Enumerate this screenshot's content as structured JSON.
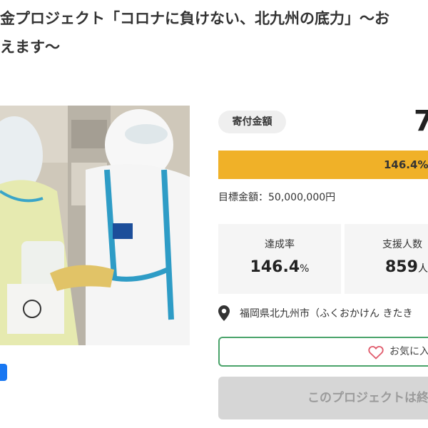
{
  "project": {
    "title_line1": "金プロジェクト「コロナに負けない、北九州の底力」〜お",
    "title_line2": "えます〜"
  },
  "donation": {
    "badge_label": "寄付金額",
    "amount": "7",
    "progress_text": "146.4%",
    "progress_fraction": 1.0,
    "goal_label": "目標金額：",
    "goal_value": "50,000,000円"
  },
  "stats": {
    "achievement_label": "達成率",
    "achievement_value": "146.4",
    "achievement_unit": "%",
    "supporters_label": "支援人数",
    "supporters_value": "859",
    "supporters_unit": "人"
  },
  "location": {
    "text": "福岡県北九州市（ふくおかけん きたき"
  },
  "actions": {
    "favorite_label": "お気に入",
    "ended_label": "このプロジェクトは終"
  },
  "colors": {
    "progress_bar": "#f0b128",
    "favorite_border": "#4aa36a",
    "share_button": "#1877f2",
    "ended_button": "#d6d6d6"
  },
  "icons": {
    "location": "pin-icon",
    "favorite": "heart-icon"
  }
}
